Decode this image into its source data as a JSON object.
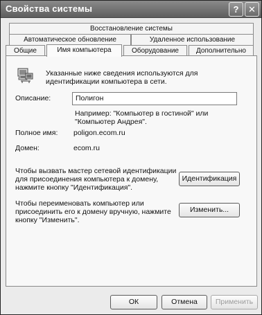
{
  "window": {
    "title": "Свойства системы",
    "help_symbol": "?",
    "close_symbol": "✕"
  },
  "tabs": {
    "row_top": [
      "Восстановление системы"
    ],
    "row_middle": [
      "Автоматическое обновление",
      "Удаленное использование"
    ],
    "row_bottom": [
      "Общие",
      "Имя компьютера",
      "Оборудование",
      "Дополнительно"
    ],
    "active": "Имя компьютера"
  },
  "panel": {
    "intro": [
      "Указанные ниже сведения используются для",
      "идентификации компьютера в сети."
    ],
    "description_label": "Описание:",
    "description_value": "Полигон",
    "example": [
      "Например: \"Компьютер в гостиной\" или",
      "\"Компьютер Андрея\"."
    ],
    "fullname_label": "Полное имя:",
    "fullname_value": "poligon.ecom.ru",
    "domain_label": "Домен:",
    "domain_value": "ecom.ru",
    "wizard_text": [
      "Чтобы вызвать мастер сетевой идентификации",
      "для присоединения компьютера к домену,",
      "нажмите кнопку \"Идентификация\"."
    ],
    "identify_button": "Идентификация",
    "rename_text": [
      "Чтобы переименовать компьютер или",
      "присоединить его к домену вручную, нажмите",
      "кнопку \"Изменить\"."
    ],
    "change_button": "Изменить..."
  },
  "footer": {
    "ok": "ОК",
    "cancel": "Отмена",
    "apply": "Применить"
  }
}
